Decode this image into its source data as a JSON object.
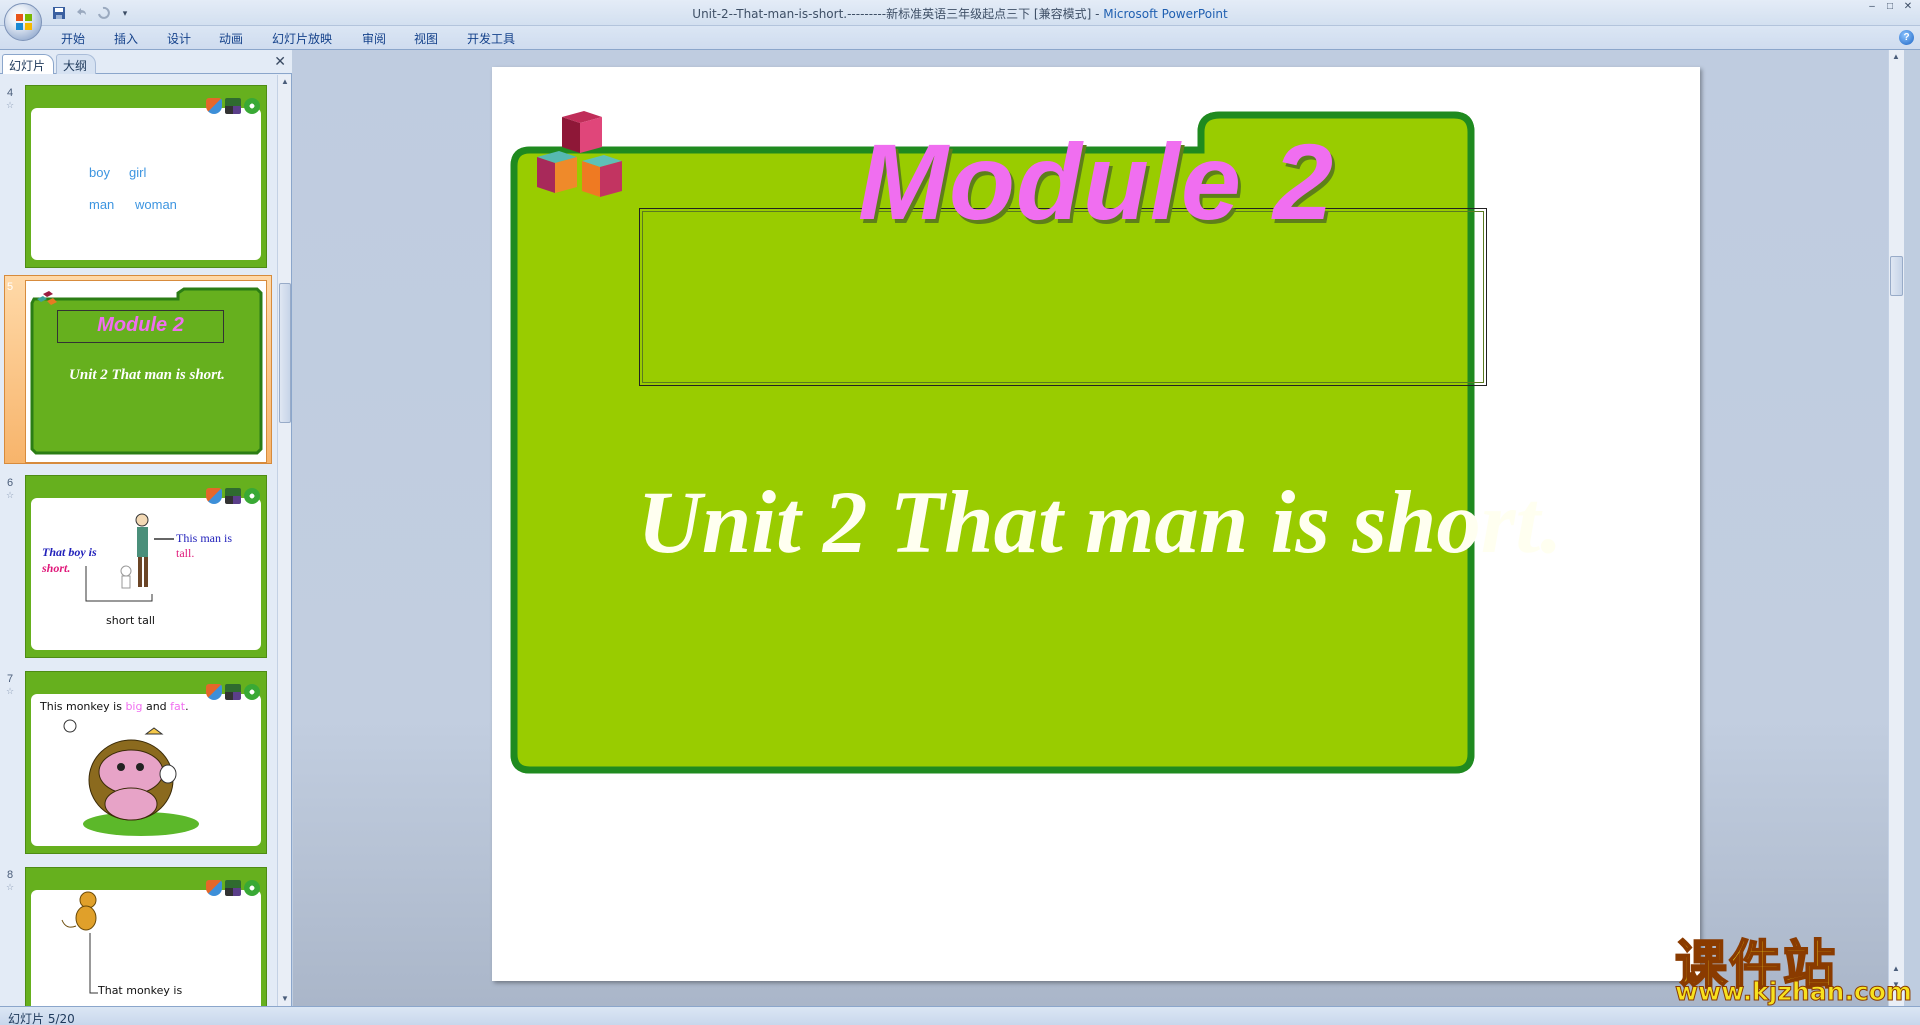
{
  "window": {
    "title_doc": "Unit-2--That-man-is-short.---------新标准英语三年级起点三下 [兼容模式] - ",
    "title_app": "Microsoft PowerPoint",
    "controls": [
      "–",
      "□",
      "✕"
    ]
  },
  "ribbon": {
    "tabs": [
      "开始",
      "插入",
      "设计",
      "动画",
      "幻灯片放映",
      "审阅",
      "视图",
      "开发工具"
    ],
    "help": "?"
  },
  "pane": {
    "tab_slides": "幻灯片",
    "tab_outline": "大纲",
    "close": "✕"
  },
  "thumbnails": [
    {
      "num": "4",
      "words": [
        "boy",
        "girl",
        "man",
        "woman"
      ]
    },
    {
      "num": "5",
      "title": "Module 2",
      "subtitle": "Unit 2  That man is short."
    },
    {
      "num": "6",
      "left_text": "That boy is",
      "left_word": "short.",
      "right_text": "This man is",
      "right_word": "tall.",
      "bottom": "short tall"
    },
    {
      "num": "7",
      "sentence_a": "This monkey is ",
      "word_big": "big",
      "and": " and ",
      "word_fat": "fat",
      "end": "."
    },
    {
      "num": "8",
      "bottom": "That monkey is"
    }
  ],
  "slide": {
    "title": "Module 2",
    "subtitle": "Unit 2  That man is short."
  },
  "watermark": {
    "cn": "课件站",
    "url": "www.kjzhan.com"
  },
  "status": {
    "slide_counter": "幻灯片 5/20"
  },
  "colors": {
    "folder_green": "#99cc00",
    "folder_border": "#1f8a1f",
    "title_pink": "#f06ef0",
    "selection_orange": "#f7b46b"
  }
}
